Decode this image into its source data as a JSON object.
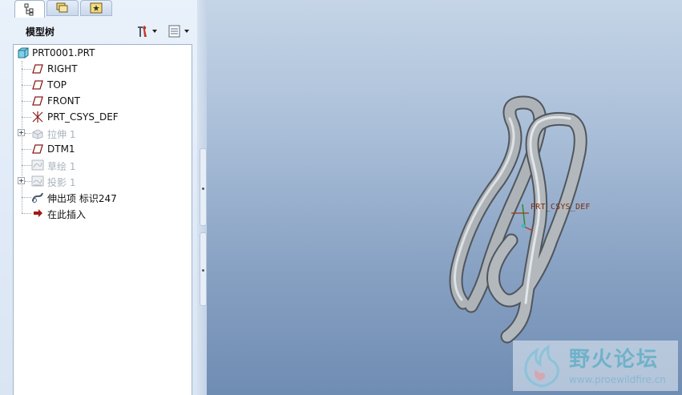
{
  "tabs": [
    {
      "name": "model-tree-tab",
      "icon": "model-tree-icon",
      "selected": true
    },
    {
      "name": "layers-tab",
      "icon": "layers-icon",
      "selected": false
    },
    {
      "name": "favorites-tab",
      "icon": "favorites-icon",
      "selected": false
    }
  ],
  "panel": {
    "title": "模型树",
    "settings_icon": "tree-settings-icon",
    "show_icon": "show-columns-icon"
  },
  "tree": {
    "root": {
      "label": "PRT0001.PRT",
      "icon": "part-icon"
    },
    "items": [
      {
        "label": "RIGHT",
        "icon": "datum-plane-icon",
        "suppressed": false,
        "expandable": false
      },
      {
        "label": "TOP",
        "icon": "datum-plane-icon",
        "suppressed": false,
        "expandable": false
      },
      {
        "label": "FRONT",
        "icon": "datum-plane-icon",
        "suppressed": false,
        "expandable": false
      },
      {
        "label": "PRT_CSYS_DEF",
        "icon": "coordinate-system-icon",
        "suppressed": false,
        "expandable": false
      },
      {
        "label": "拉伸 1",
        "icon": "extrude-icon",
        "suppressed": true,
        "expandable": true
      },
      {
        "label": "DTM1",
        "icon": "datum-plane-icon",
        "suppressed": false,
        "expandable": false
      },
      {
        "label": "草绘 1",
        "icon": "sketch-icon",
        "suppressed": true,
        "expandable": false
      },
      {
        "label": "投影 1",
        "icon": "projection-icon",
        "suppressed": true,
        "expandable": true
      },
      {
        "label": "伸出项 标识247",
        "icon": "sweep-protrusion-icon",
        "suppressed": false,
        "expandable": false
      },
      {
        "label": "在此插入",
        "icon": "insert-here-arrow-icon",
        "suppressed": false,
        "expandable": false
      }
    ]
  },
  "viewport": {
    "csys_label": "PRT_CSYS_DEF",
    "model": "swept-wire-clip"
  },
  "watermark": {
    "title": "野火论坛",
    "url": "www.proewildfire.cn"
  },
  "colors": {
    "panel_bg": "#e3ecf7",
    "viewport_top": "#c5d5e7",
    "viewport_bottom": "#6f8cb2",
    "model_shade": "#a7acb1",
    "suppressed_text": "#aab2bd"
  }
}
